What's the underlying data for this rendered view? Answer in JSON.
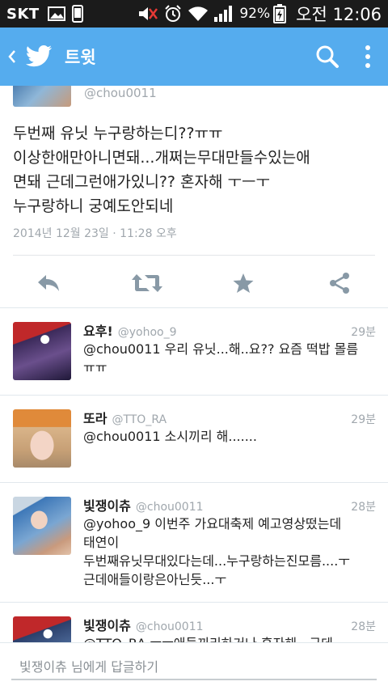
{
  "status_bar": {
    "carrier": "SKT",
    "battery_percent": "92%",
    "time": "오전 12:06"
  },
  "app_bar": {
    "title": "트윗",
    "icons": [
      "back-icon",
      "twitter-bird-icon",
      "search-icon",
      "overflow-menu-icon"
    ],
    "color": "#55acee"
  },
  "main_tweet": {
    "handle": "@chou0011",
    "text_lines": [
      "두번째 유닛 누구랑하는디??ㅠㅠ",
      "이상한애만아니면돼...개쩌는무대만들수있는애",
      "면돼 근데그런애가있니?? 혼자해 ㅜㅡㅜ",
      "누구랑하니 궁예도안되네"
    ],
    "date": "2014년 12월 23일 · 11:28 오후",
    "actions": [
      "reply-icon",
      "retweet-icon",
      "favorite-icon",
      "share-icon"
    ]
  },
  "replies": [
    {
      "name": "요후!",
      "handle": "@yohoo_9",
      "time": "29분",
      "lines": [
        "@chou0011 우리 유닛...해..요?? 요즘 떡밥 몰름",
        "ㅠㅠ"
      ]
    },
    {
      "name": "또라",
      "handle": "@TTO_RA",
      "time": "29분",
      "lines": [
        "@chou0011 소시끼리 해......."
      ]
    },
    {
      "name": "빛쟁이츄",
      "handle": "@chou0011",
      "time": "28분",
      "lines": [
        "@yohoo_9 이번주 가요대축제 예고영상떴는데",
        "태연이",
        "두번째유닛무대있다는데...누구랑하는진모름....ㅜ",
        "근데애들이랑은아닌듯...ㅜ"
      ]
    },
    {
      "name": "빛쟁이츄",
      "handle": "@chou0011",
      "time": "28분",
      "lines": [
        "@TTO_RA ㅜㅜ애들끼리하거나 혼자해...근데"
      ]
    }
  ],
  "reply_bar": {
    "placeholder": "빛쟁이츄 님에게 답글하기"
  }
}
